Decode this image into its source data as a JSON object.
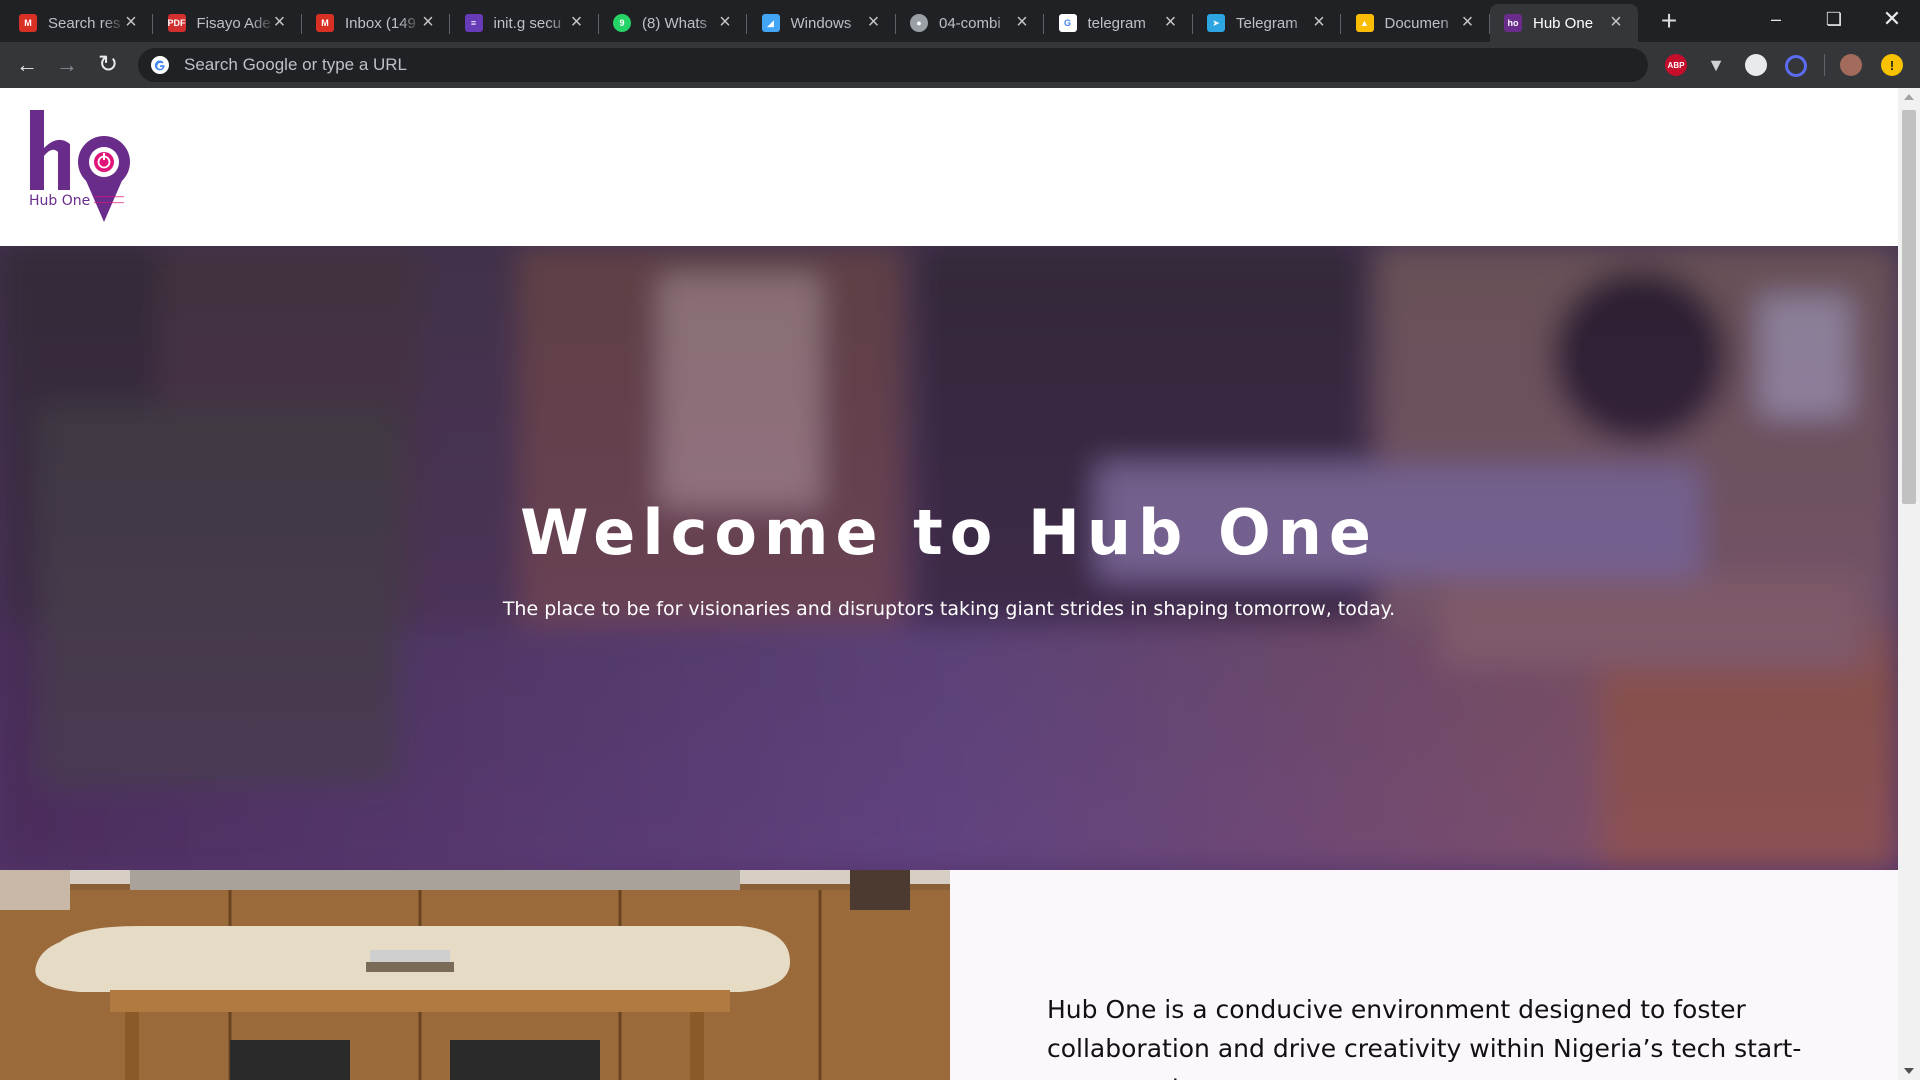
{
  "browser": {
    "tabs": [
      {
        "title": "Search res",
        "favicon": "gmail-icon",
        "color": "#d93025"
      },
      {
        "title": "Fisayo Ade",
        "favicon": "pdf-icon",
        "color": "#d32f2f"
      },
      {
        "title": "Inbox (149",
        "favicon": "gmail-icon",
        "color": "#d93025"
      },
      {
        "title": "init.g secu",
        "favicon": "forms-icon",
        "color": "#673ab7"
      },
      {
        "title": "(8) Whats",
        "favicon": "whatsapp-icon",
        "color": "#25d366"
      },
      {
        "title": "Windows",
        "favicon": "flutter-icon",
        "color": "#42a5f5"
      },
      {
        "title": "04-combi",
        "favicon": "globe-icon",
        "color": "#9aa0a6"
      },
      {
        "title": "telegram",
        "favicon": "google-icon",
        "color": "#ffffff"
      },
      {
        "title": "Telegram",
        "favicon": "telegram-icon",
        "color": "#2ca5e0"
      },
      {
        "title": "Documen",
        "favicon": "drive-icon",
        "color": "#fbbc04"
      },
      {
        "title": "Hub One",
        "favicon": "hubone-icon",
        "color": "#6a2c8a",
        "active": true
      }
    ],
    "new_tab_label": "+",
    "omnibox": {
      "placeholder": "Search Google or type a URL",
      "value": ""
    },
    "extensions": [
      {
        "name": "adblock-plus-icon",
        "label": "ABP",
        "color": "#c70d2c"
      },
      {
        "name": "vivaldi-v-icon",
        "label": "",
        "color": "#9aa0a6"
      },
      {
        "name": "extension-white-icon",
        "label": "",
        "color": "#e8eaed"
      },
      {
        "name": "extension-blue-ring-icon",
        "label": "",
        "color": "#5b6cf0"
      },
      {
        "name": "profile-avatar-icon",
        "label": "",
        "color": "#a36b5c"
      },
      {
        "name": "update-alert-icon",
        "label": "!",
        "color": "#f9c200"
      }
    ]
  },
  "site": {
    "logo_letters": "ho",
    "logo_name": "Hub One",
    "hero": {
      "title": "Welcome to Hub One",
      "subtitle": "The place to be for visionaries and disruptors taking giant strides in shaping tomorrow, today."
    },
    "about": {
      "text": "Hub One is a conducive environment designed to foster collaboration and drive creativity within Nigeria’s tech start-up ecosystem."
    }
  },
  "colors": {
    "brand_purple": "#6a2c8a",
    "brand_pink": "#e0147a",
    "chrome_dark": "#202124",
    "chrome_toolbar": "#35363a"
  }
}
